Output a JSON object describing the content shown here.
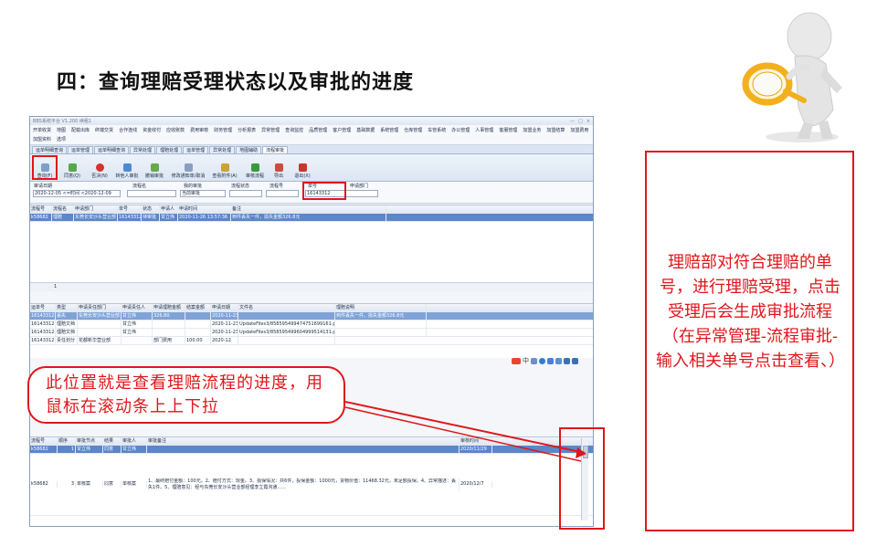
{
  "slide": {
    "title": "四：查询理赔受理状态以及审批的进度",
    "callout": "此位置就是查看理赔流程的进度，用鼠标在滚动条上上下拉",
    "note": "理赔部对符合理赔的单号，进行理赔受理，点击受理后会生成审批流程（在异常管理-流程审批-输入相关单号点击查看、）"
  },
  "colors": {
    "accent_red": "#e0161b",
    "selection_blue": "#5b86c9",
    "figure_yellow": "#f2b01e"
  },
  "app": {
    "title": "BBS系统平台 V1.200    续租1",
    "menu": [
      "开单收货",
      "地图",
      "配载出库",
      "终端交货",
      "合作连线",
      "资金收付",
      "应收账款",
      "费用审核",
      "财务管理",
      "分析报表",
      "异常管理",
      "查询监控",
      "品质管理",
      "客户管理",
      "基础数据",
      "系统管理",
      "仓库管理",
      "车管系统",
      "办公管理",
      "人事管理",
      "客服管理",
      "加盟业务",
      "加盟结算",
      "加盟费用",
      "加盟资料",
      "选项"
    ],
    "tabs": [
      "运单明细查询",
      "运单管理",
      "运单明细查询",
      "异常处理",
      "理赔处理",
      "运单管理",
      "异常处理",
      "地图辅助",
      "流程审批"
    ],
    "toolbar": [
      {
        "label": "查询(F)",
        "icon": "search-icon",
        "color": "#7fa0c9"
      },
      {
        "label": "同意(Q)",
        "icon": "approve-icon",
        "color": "#59a64b"
      },
      {
        "label": "否决(N)",
        "icon": "reject-icon",
        "color": "#d8322b"
      },
      {
        "label": "转他人审批",
        "icon": "forward-icon",
        "color": "#4f8ad1"
      },
      {
        "label": "撤销审批",
        "icon": "undo-approve-icon",
        "color": "#6aa84f"
      },
      {
        "label": "修改通知单/取消",
        "icon": "edit-icon",
        "color": "#8a9fc0"
      },
      {
        "label": "查看附件(A)",
        "icon": "attachment-icon",
        "color": "#c9a23b"
      },
      {
        "label": "审核流程",
        "icon": "flow-icon",
        "color": "#3a9a3e"
      },
      {
        "label": "导出",
        "icon": "export-icon",
        "color": "#d04a3f"
      },
      {
        "label": "退出(X)",
        "icon": "exit-icon",
        "color": "#c9342d"
      }
    ],
    "filters": {
      "date_label": "审请日期",
      "date_value": "2020-12-05 <=时间 <2020-12-09",
      "flow_name_label": "流程名",
      "my_approval_label": "我的审批",
      "my_approval_value": "当前审批",
      "flow_status_label": "流程状态",
      "flow_no_label": "流程号",
      "order_no_label": "单号",
      "order_no_value": "16143312",
      "apply_dept_label": "申请部门"
    },
    "grid1": {
      "headers": [
        "流程号",
        "流程名",
        "申请部门",
        "单号",
        "状态",
        "申请人",
        "申请时间",
        "备注"
      ],
      "rows": [
        [
          "k58682",
          "理赔",
          "东莞长安沙头营业部",
          "16143312",
          "待审批",
          "甘立伟",
          "2020-11-26 13:57:36",
          "到件丢失一件，损失金额326.8元"
        ]
      ],
      "footer": "1"
    },
    "grid2": {
      "headers": [
        "运单号",
        "类型",
        "申请责任部门",
        "申请责任人",
        "申请理赔金额",
        "结案金额",
        "申请日期",
        "文件名",
        "理赔说明"
      ],
      "rows": [
        [
          "16143312",
          "丢失",
          "东莞长安沙头营业部",
          "甘立伟",
          "326.80",
          "",
          "2020-11-23",
          "",
          "到件丢失一件，损失金额326.8元"
        ],
        [
          "16143312",
          "理赔文档",
          "",
          "甘立伟",
          "",
          "",
          "2020-11-23",
          "UpdateFiles3/858595499474751699161.png",
          ""
        ],
        [
          "16143312",
          "理赔文档",
          "",
          "甘立伟",
          "",
          "",
          "2020-11-23",
          "UpdateFiles3/858595499604999514131.png",
          ""
        ],
        [
          "16143312",
          "责任划分",
          "花都新华营业部",
          "",
          "部门费用",
          "100.00",
          "2020-12",
          ""
        ]
      ]
    },
    "grid3": {
      "headers": [
        "流程号",
        "顺序",
        "审批节点",
        "结果",
        "审批人",
        "审批备注",
        "审核时间"
      ],
      "rows": [
        [
          "k58682",
          "1",
          "甘立伟",
          "同意",
          "甘立伟",
          "",
          "2020/11/29"
        ],
        [
          "k58682",
          "3",
          "单核案",
          "同意",
          "单核案",
          "1、最终赔付金额：100元。2、赔付方式：现金。3、损保情况：共6件，投保金额：1000元，货物价值：11468.32元，未足额投保。4、异常描述：丢失1件。5、理赔意见：经与东莞长安沙头营业部经理李立霞沟通……",
          "2020/12/7"
        ]
      ]
    },
    "ime_label": "中"
  }
}
